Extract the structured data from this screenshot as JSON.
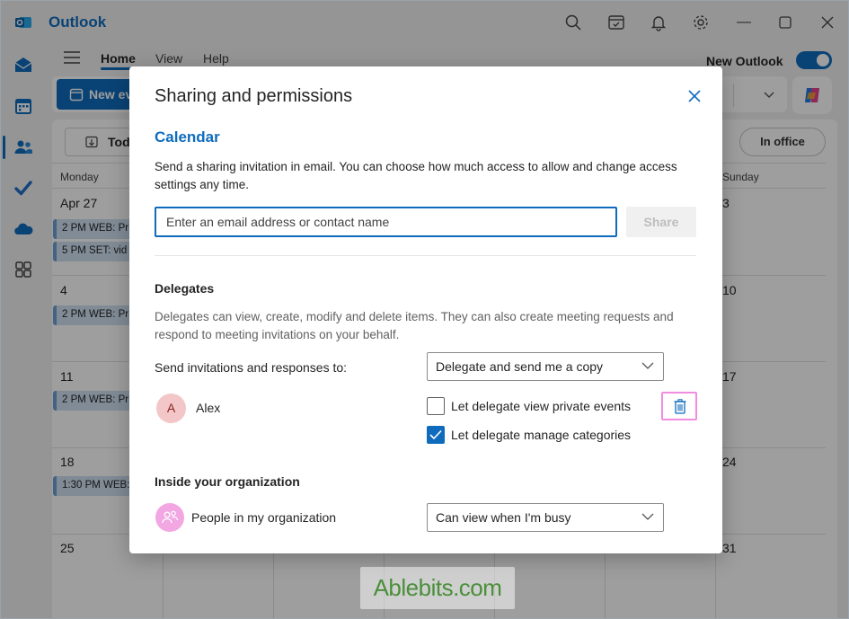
{
  "app": {
    "title": "Outlook"
  },
  "ribbon": {
    "tabs": [
      {
        "label": "Home"
      },
      {
        "label": "View"
      },
      {
        "label": "Help"
      }
    ],
    "new_outlook_label": "New Outlook",
    "new_outlook_on": true,
    "new_event_label": "New ev"
  },
  "calendar": {
    "today_label": "Tod",
    "in_office_label": "In office",
    "day_headers": {
      "monday": "Monday",
      "sunday": "Sunday"
    },
    "monday_dates": [
      "Apr 27",
      "4",
      "11",
      "18",
      "25"
    ],
    "sunday_dates": [
      "3",
      "10",
      "17",
      "24",
      "31"
    ],
    "events": [
      {
        "text": "2 PM WEB: Pr"
      },
      {
        "text": "5 PM SET: vid"
      },
      {
        "text": "2 PM WEB: Pr"
      },
      {
        "text": "2 PM WEB: Pr"
      },
      {
        "text": "1:30 PM WEB:"
      }
    ]
  },
  "dialog": {
    "title": "Sharing and permissions",
    "section_title": "Calendar",
    "description": "Send a sharing invitation in email. You can choose how much access to allow and change access settings any time.",
    "email_placeholder": "Enter an email address or contact name",
    "share_label": "Share",
    "delegates": {
      "heading": "Delegates",
      "description": "Delegates can view, create, modify and delete items. They can also create meeting requests and respond to meeting invitations on your behalf.",
      "send_to_label": "Send invitations and responses to:",
      "send_to_value": "Delegate and send me a copy",
      "delegate": {
        "initial": "A",
        "name": "Alex",
        "options": [
          {
            "label": "Let delegate view private events",
            "checked": false
          },
          {
            "label": "Let delegate manage categories",
            "checked": true
          }
        ]
      }
    },
    "organization": {
      "heading": "Inside your organization",
      "label": "People in my organization",
      "permission": "Can view when I'm busy"
    }
  },
  "watermark": {
    "text": "Ablebits.com"
  },
  "colors": {
    "accent": "#0f6cbd",
    "highlight": "#f28ce0"
  }
}
